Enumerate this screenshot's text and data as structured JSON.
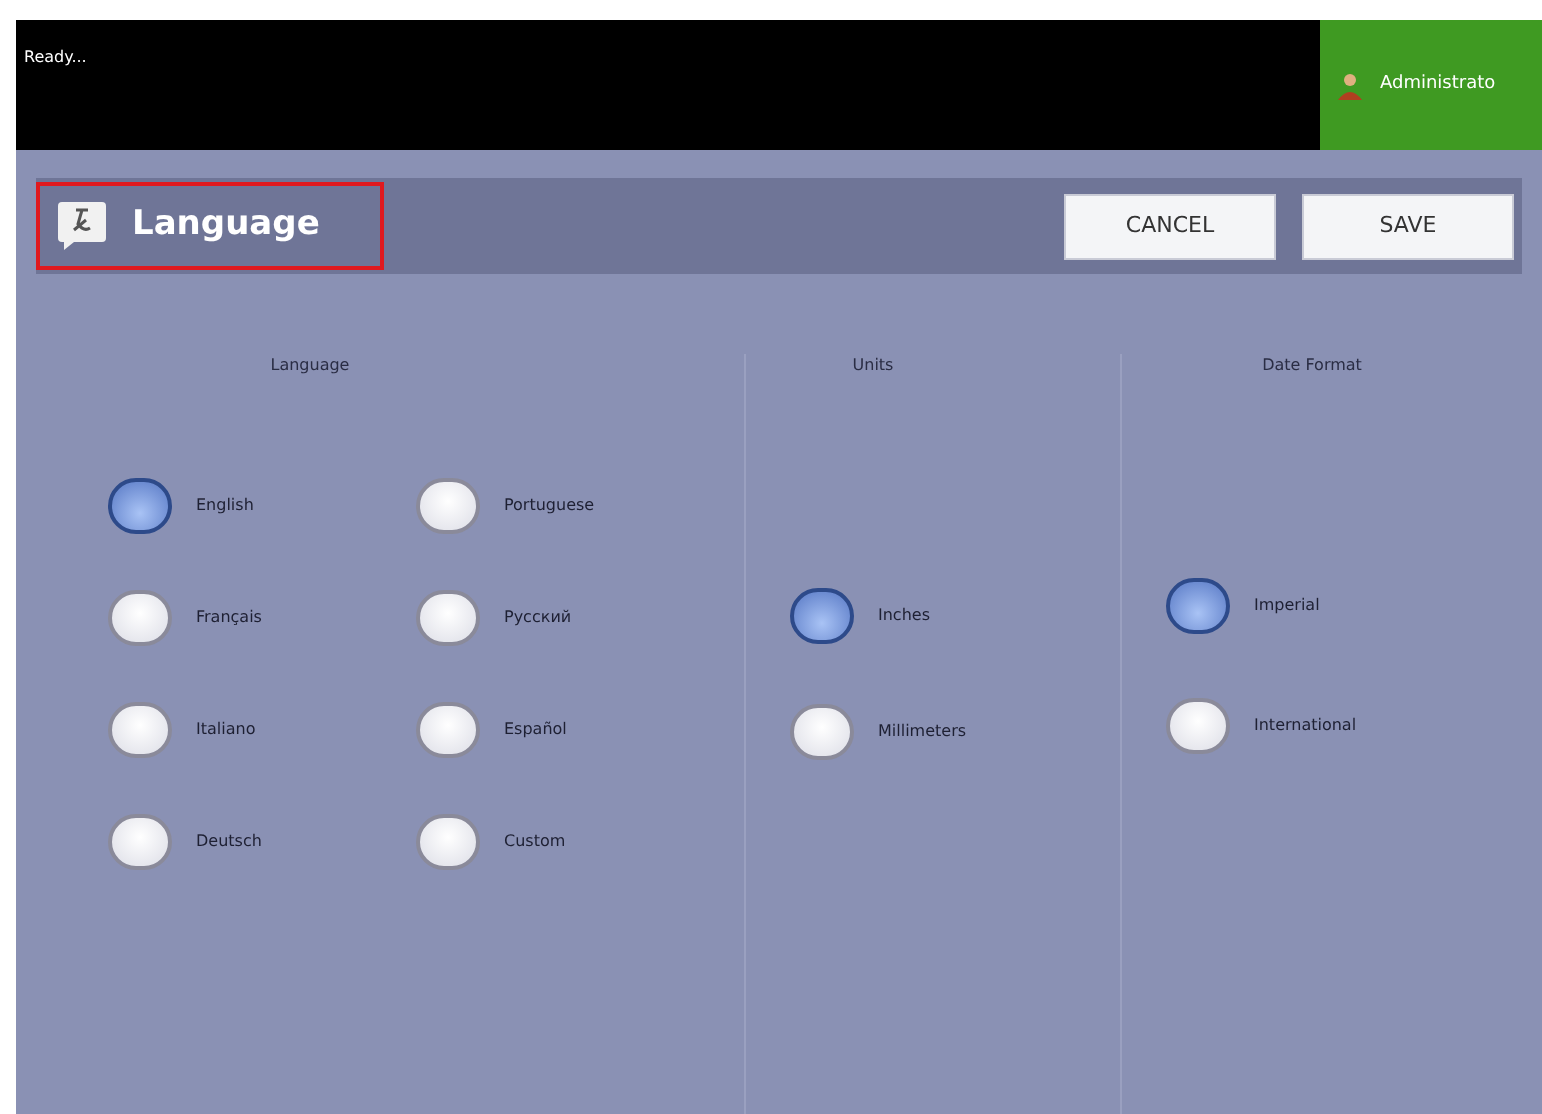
{
  "status_bar": {
    "message": "Ready...",
    "user": "Administrato"
  },
  "header": {
    "title": "Language",
    "buttons": [
      "CANCEL",
      "SAVE"
    ]
  },
  "groups": [
    {
      "title": "Language",
      "options": [
        {
          "label": "English",
          "selected": true
        },
        {
          "label": "Français",
          "selected": false
        },
        {
          "label": "Italiano",
          "selected": false
        },
        {
          "label": "Deutsch",
          "selected": false
        },
        {
          "label": "Portuguese",
          "selected": false
        },
        {
          "label": "Русский",
          "selected": false
        },
        {
          "label": "Español",
          "selected": false
        },
        {
          "label": "Custom",
          "selected": false
        }
      ]
    },
    {
      "title": "Units",
      "options": [
        {
          "label": "Inches",
          "selected": true
        },
        {
          "label": "Millimeters",
          "selected": false
        }
      ]
    },
    {
      "title": "Date Format",
      "options": [
        {
          "label": "Imperial",
          "selected": true
        },
        {
          "label": "International",
          "selected": false
        }
      ]
    }
  ]
}
